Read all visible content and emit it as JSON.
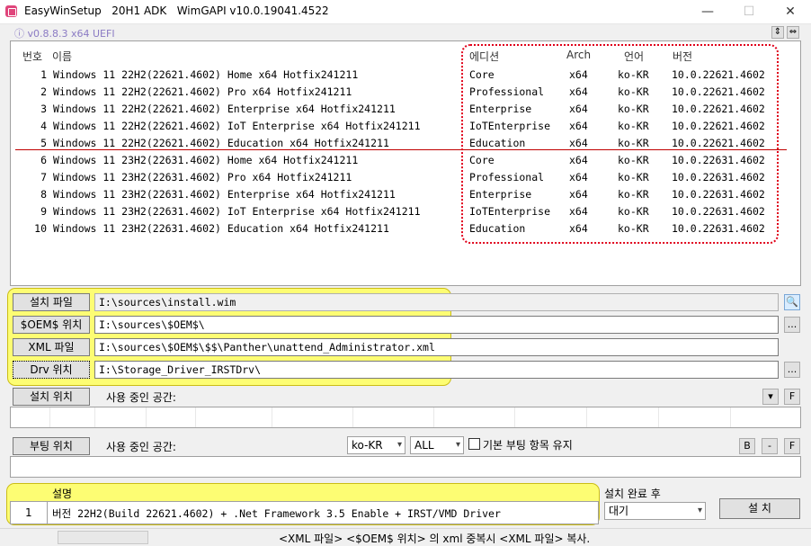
{
  "window": {
    "title": "EasyWinSetup   20H1 ADK   WimGAPI v10.0.19041.4522",
    "min_glyph": "—",
    "max_glyph": "☐",
    "close_glyph": "✕"
  },
  "version_label": "ⓘ v0.8.8.3 x64 UEFI",
  "top_buttons": {
    "collapse": "⇕",
    "expand": "⇔"
  },
  "list": {
    "headers": {
      "num": "번호",
      "name": "이름",
      "edition": "에디션",
      "arch": "Arch",
      "lang": "언어",
      "version": "버전"
    },
    "rows": [
      {
        "num": "1",
        "name": "Windows 11 22H2(22621.4602) Home x64 Hotfix241211",
        "edition": "Core",
        "arch": "x64",
        "lang": "ko-KR",
        "version": "10.0.22621.4602"
      },
      {
        "num": "2",
        "name": "Windows 11 22H2(22621.4602) Pro x64 Hotfix241211",
        "edition": "Professional",
        "arch": "x64",
        "lang": "ko-KR",
        "version": "10.0.22621.4602"
      },
      {
        "num": "3",
        "name": "Windows 11 22H2(22621.4602) Enterprise x64 Hotfix241211",
        "edition": "Enterprise",
        "arch": "x64",
        "lang": "ko-KR",
        "version": "10.0.22621.4602"
      },
      {
        "num": "4",
        "name": "Windows 11 22H2(22621.4602) IoT Enterprise x64 Hotfix241211",
        "edition": "IoTEnterprise",
        "arch": "x64",
        "lang": "ko-KR",
        "version": "10.0.22621.4602"
      },
      {
        "num": "5",
        "name": "Windows 11 22H2(22621.4602) Education x64 Hotfix241211",
        "edition": "Education",
        "arch": "x64",
        "lang": "ko-KR",
        "version": "10.0.22621.4602"
      },
      {
        "num": "6",
        "name": "Windows 11 23H2(22631.4602) Home x64 Hotfix241211",
        "edition": "Core",
        "arch": "x64",
        "lang": "ko-KR",
        "version": "10.0.22631.4602"
      },
      {
        "num": "7",
        "name": "Windows 11 23H2(22631.4602) Pro x64 Hotfix241211",
        "edition": "Professional",
        "arch": "x64",
        "lang": "ko-KR",
        "version": "10.0.22631.4602"
      },
      {
        "num": "8",
        "name": "Windows 11 23H2(22631.4602) Enterprise x64 Hotfix241211",
        "edition": "Enterprise",
        "arch": "x64",
        "lang": "ko-KR",
        "version": "10.0.22631.4602"
      },
      {
        "num": "9",
        "name": "Windows 11 23H2(22631.4602) IoT Enterprise x64 Hotfix241211",
        "edition": "IoTEnterprise",
        "arch": "x64",
        "lang": "ko-KR",
        "version": "10.0.22631.4602"
      },
      {
        "num": "10",
        "name": "Windows 11 23H2(22631.4602) Education x64 Hotfix241211",
        "edition": "Education",
        "arch": "x64",
        "lang": "ko-KR",
        "version": "10.0.22631.4602"
      }
    ]
  },
  "paths": {
    "install_file_label": "설치 파일",
    "install_file_value": "I:\\sources\\install.wim",
    "oem_label": "$OEM$ 위치",
    "oem_value": "I:\\sources\\$OEM$\\",
    "xml_label": "XML 파일",
    "xml_value": "I:\\sources\\$OEM$\\$$\\Panther\\unattend_Administrator.xml",
    "drv_label": "Drv 위치",
    "drv_value": "I:\\Storage_Driver_IRSTDrv\\",
    "browse_glyph": "...",
    "search_glyph": "🔍"
  },
  "install_target": {
    "button": "설치 위치",
    "space_label": "사용 중인 공간:",
    "dropdown_glyph": "▾",
    "f_button": "F"
  },
  "boot_target": {
    "button": "부팅 위치",
    "space_label": "사용 중인 공간:",
    "lang_select": "ko-KR",
    "scope_select": "ALL",
    "keep_boot_label": "기본 부팅 항목 유지",
    "keep_boot_checked": false,
    "b_button": "B",
    "minus_button": "-",
    "f_button": "F"
  },
  "notes": {
    "header": "설명",
    "row_num": "1",
    "row_text": "버전 22H2(Build 22621.4602) + .Net Framework 3.5 Enable + IRST/VMD Driver"
  },
  "after_install": {
    "label": "설치 완료 후",
    "select_value": "대기",
    "install_button": "설 치"
  },
  "status": {
    "text": "<XML 파일> <$OEM$ 위치> 의 xml 중복시 <XML 파일> 복사."
  },
  "colors": {
    "highlight": "#ffff66",
    "dotted_border": "#e0001a",
    "separator": "#c00000",
    "version_text": "#8b7bc4"
  }
}
